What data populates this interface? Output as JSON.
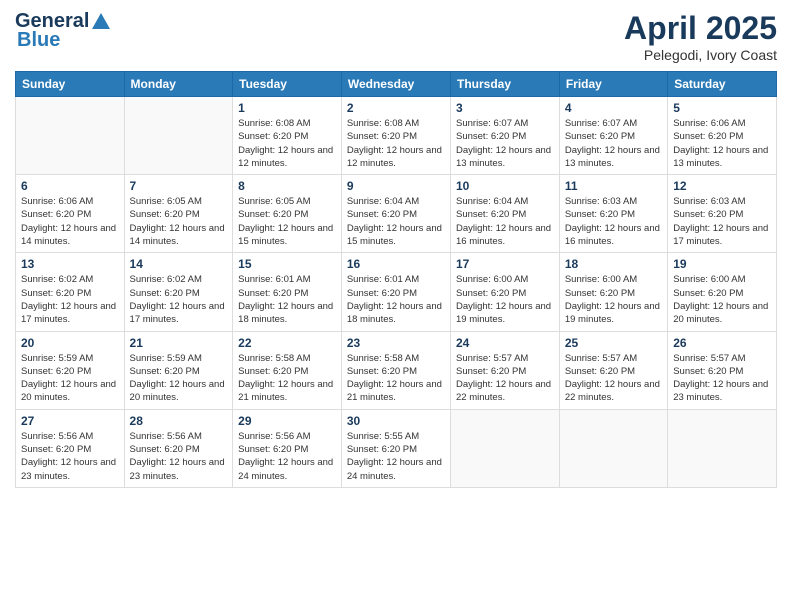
{
  "header": {
    "logo_general": "General",
    "logo_blue": "Blue",
    "title": "April 2025",
    "subtitle": "Pelegodi, Ivory Coast"
  },
  "calendar": {
    "days_of_week": [
      "Sunday",
      "Monday",
      "Tuesday",
      "Wednesday",
      "Thursday",
      "Friday",
      "Saturday"
    ],
    "weeks": [
      [
        {
          "day": "",
          "info": ""
        },
        {
          "day": "",
          "info": ""
        },
        {
          "day": "1",
          "info": "Sunrise: 6:08 AM\nSunset: 6:20 PM\nDaylight: 12 hours and 12 minutes."
        },
        {
          "day": "2",
          "info": "Sunrise: 6:08 AM\nSunset: 6:20 PM\nDaylight: 12 hours and 12 minutes."
        },
        {
          "day": "3",
          "info": "Sunrise: 6:07 AM\nSunset: 6:20 PM\nDaylight: 12 hours and 13 minutes."
        },
        {
          "day": "4",
          "info": "Sunrise: 6:07 AM\nSunset: 6:20 PM\nDaylight: 12 hours and 13 minutes."
        },
        {
          "day": "5",
          "info": "Sunrise: 6:06 AM\nSunset: 6:20 PM\nDaylight: 12 hours and 13 minutes."
        }
      ],
      [
        {
          "day": "6",
          "info": "Sunrise: 6:06 AM\nSunset: 6:20 PM\nDaylight: 12 hours and 14 minutes."
        },
        {
          "day": "7",
          "info": "Sunrise: 6:05 AM\nSunset: 6:20 PM\nDaylight: 12 hours and 14 minutes."
        },
        {
          "day": "8",
          "info": "Sunrise: 6:05 AM\nSunset: 6:20 PM\nDaylight: 12 hours and 15 minutes."
        },
        {
          "day": "9",
          "info": "Sunrise: 6:04 AM\nSunset: 6:20 PM\nDaylight: 12 hours and 15 minutes."
        },
        {
          "day": "10",
          "info": "Sunrise: 6:04 AM\nSunset: 6:20 PM\nDaylight: 12 hours and 16 minutes."
        },
        {
          "day": "11",
          "info": "Sunrise: 6:03 AM\nSunset: 6:20 PM\nDaylight: 12 hours and 16 minutes."
        },
        {
          "day": "12",
          "info": "Sunrise: 6:03 AM\nSunset: 6:20 PM\nDaylight: 12 hours and 17 minutes."
        }
      ],
      [
        {
          "day": "13",
          "info": "Sunrise: 6:02 AM\nSunset: 6:20 PM\nDaylight: 12 hours and 17 minutes."
        },
        {
          "day": "14",
          "info": "Sunrise: 6:02 AM\nSunset: 6:20 PM\nDaylight: 12 hours and 17 minutes."
        },
        {
          "day": "15",
          "info": "Sunrise: 6:01 AM\nSunset: 6:20 PM\nDaylight: 12 hours and 18 minutes."
        },
        {
          "day": "16",
          "info": "Sunrise: 6:01 AM\nSunset: 6:20 PM\nDaylight: 12 hours and 18 minutes."
        },
        {
          "day": "17",
          "info": "Sunrise: 6:00 AM\nSunset: 6:20 PM\nDaylight: 12 hours and 19 minutes."
        },
        {
          "day": "18",
          "info": "Sunrise: 6:00 AM\nSunset: 6:20 PM\nDaylight: 12 hours and 19 minutes."
        },
        {
          "day": "19",
          "info": "Sunrise: 6:00 AM\nSunset: 6:20 PM\nDaylight: 12 hours and 20 minutes."
        }
      ],
      [
        {
          "day": "20",
          "info": "Sunrise: 5:59 AM\nSunset: 6:20 PM\nDaylight: 12 hours and 20 minutes."
        },
        {
          "day": "21",
          "info": "Sunrise: 5:59 AM\nSunset: 6:20 PM\nDaylight: 12 hours and 20 minutes."
        },
        {
          "day": "22",
          "info": "Sunrise: 5:58 AM\nSunset: 6:20 PM\nDaylight: 12 hours and 21 minutes."
        },
        {
          "day": "23",
          "info": "Sunrise: 5:58 AM\nSunset: 6:20 PM\nDaylight: 12 hours and 21 minutes."
        },
        {
          "day": "24",
          "info": "Sunrise: 5:57 AM\nSunset: 6:20 PM\nDaylight: 12 hours and 22 minutes."
        },
        {
          "day": "25",
          "info": "Sunrise: 5:57 AM\nSunset: 6:20 PM\nDaylight: 12 hours and 22 minutes."
        },
        {
          "day": "26",
          "info": "Sunrise: 5:57 AM\nSunset: 6:20 PM\nDaylight: 12 hours and 23 minutes."
        }
      ],
      [
        {
          "day": "27",
          "info": "Sunrise: 5:56 AM\nSunset: 6:20 PM\nDaylight: 12 hours and 23 minutes."
        },
        {
          "day": "28",
          "info": "Sunrise: 5:56 AM\nSunset: 6:20 PM\nDaylight: 12 hours and 23 minutes."
        },
        {
          "day": "29",
          "info": "Sunrise: 5:56 AM\nSunset: 6:20 PM\nDaylight: 12 hours and 24 minutes."
        },
        {
          "day": "30",
          "info": "Sunrise: 5:55 AM\nSunset: 6:20 PM\nDaylight: 12 hours and 24 minutes."
        },
        {
          "day": "",
          "info": ""
        },
        {
          "day": "",
          "info": ""
        },
        {
          "day": "",
          "info": ""
        }
      ]
    ]
  }
}
